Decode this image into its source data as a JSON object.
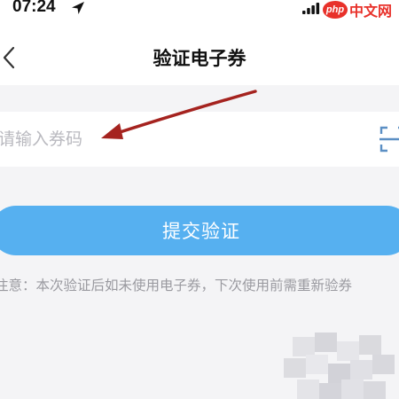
{
  "status_bar": {
    "time": "07:24",
    "watermark_logo": "php",
    "watermark_text": "中文网"
  },
  "nav": {
    "title": "验证电子券"
  },
  "form": {
    "code_input_value": "",
    "code_input_placeholder": "请输入券码"
  },
  "submit": {
    "label": "提交验证",
    "color": "#56b0f0"
  },
  "notice": {
    "text": "注意：本次验证后如未使用电子券，下次使用前需重新验券"
  },
  "icons": {
    "back": "chevron-left-icon",
    "scan": "scan-icon",
    "location": "location-arrow-icon",
    "signal": "signal-icon",
    "wifi": "wifi-icon"
  },
  "colors": {
    "accent": "#56b0f0",
    "annotation_arrow": "#a5231f",
    "background": "#f4f4f6"
  }
}
